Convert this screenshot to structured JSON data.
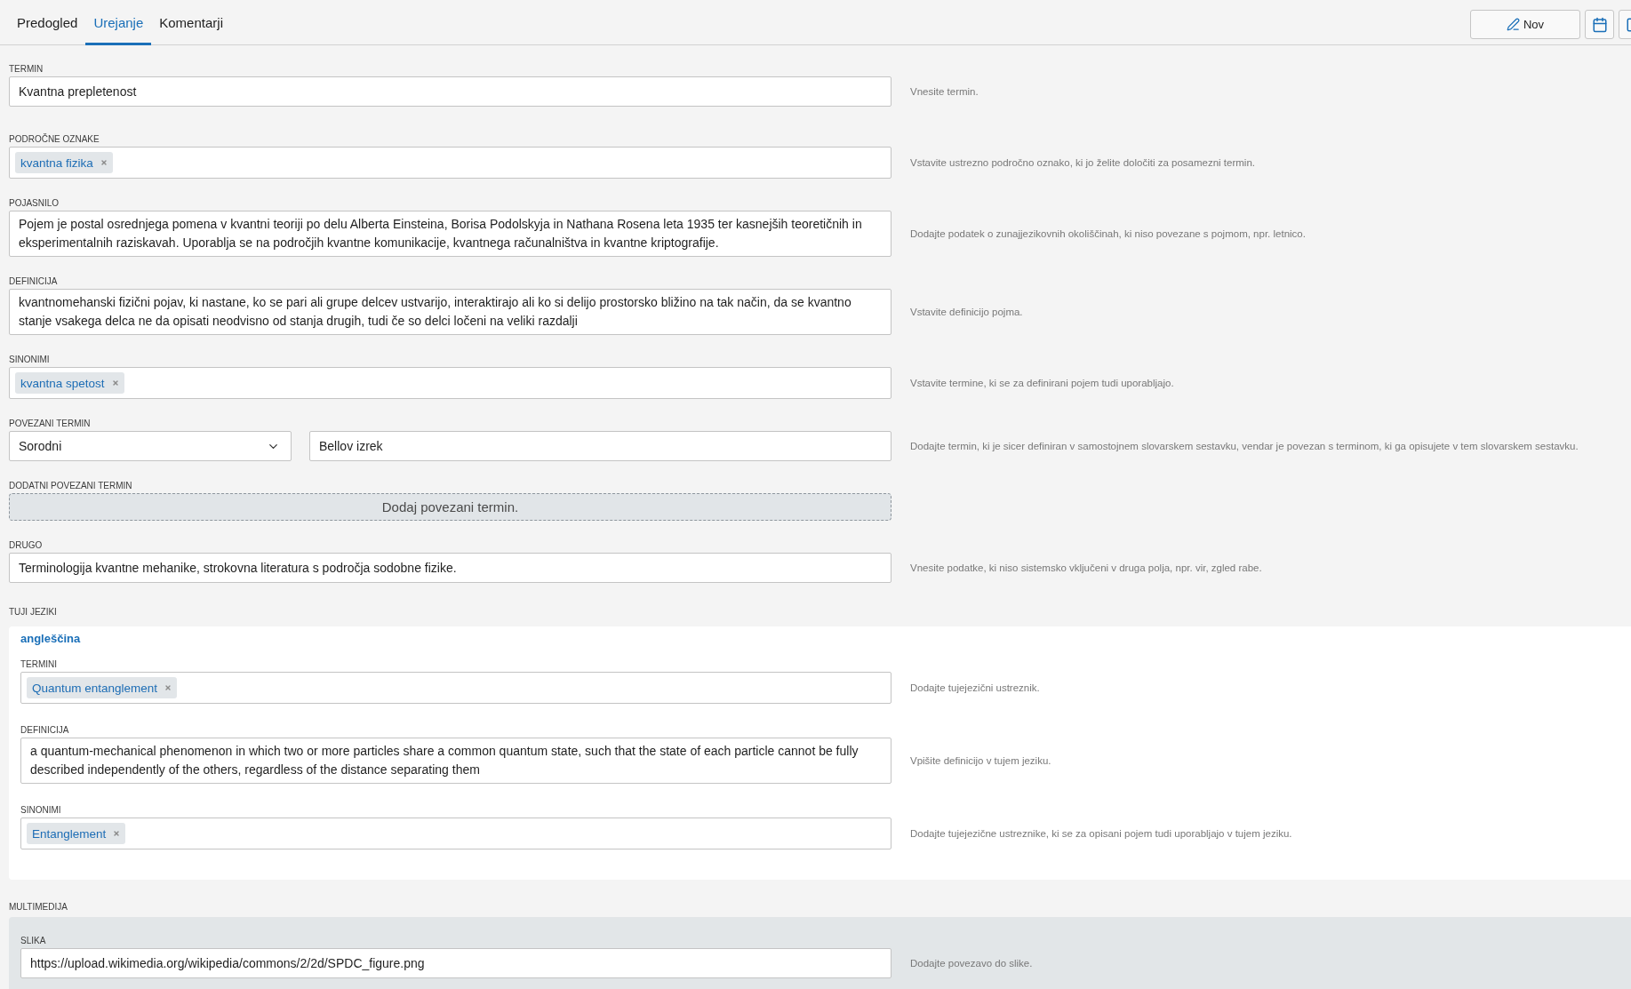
{
  "tabs": [
    {
      "label": "Predogled",
      "selected": false
    },
    {
      "label": "Urejanje",
      "selected": true
    },
    {
      "label": "Komentarji",
      "selected": false
    }
  ],
  "toolbar": {
    "new_button": {
      "label": "Nov"
    }
  },
  "fields": [
    {
      "kind": "text",
      "label": "TERMIN",
      "value": "Kvantna prepletenost",
      "hint": "Vnesite termin."
    },
    {
      "kind": "tags",
      "label": "PODROČNE OZNAKE",
      "tags": [
        "kvantna fizika"
      ],
      "hint": "Vstavite ustrezno področno oznako, ki jo želite določiti za posamezni termin."
    },
    {
      "kind": "textarea",
      "label": "POJASNILO",
      "value": "Pojem je postal osrednjega pomena v kvantni teoriji po delu Alberta Einsteina, Borisa Podolskyja in Nathana Rosena leta 1935 ter kasnejših teoretičnih in eksperimentalnih raziskavah. Uporablja se na področjih kvantne komunikacije, kvantnega računalništva in kvantne kriptografije.",
      "hint": "Dodajte podatek o zunajjezikovnih okoliščinah, ki niso povezane s pojmom, npr. letnico."
    },
    {
      "kind": "textarea",
      "label": "DEFINICIJA",
      "value": "kvantnomehanski fizični pojav, ki nastane, ko se pari ali grupe delcev ustvarijo, interaktirajo ali ko si delijo prostorsko bližino na tak način, da se kvantno stanje vsakega delca ne da opisati neodvisno od stanja drugih, tudi če so delci ločeni na veliki razdalji",
      "hint": "Vstavite definicijo pojma."
    },
    {
      "kind": "tags",
      "label": "SINONIMI",
      "tags": [
        "kvantna spetost"
      ],
      "hint": "Vstavite termine, ki se za definirani pojem tudi uporabljajo."
    },
    {
      "kind": "related",
      "label": "POVEZANI TERMIN",
      "relation": "Sorodni",
      "value": "Bellov izrek",
      "hint": "Dodajte termin, ki je sicer definiran v samostojnem slovarskem sestavku, vendar je povezan s terminom, ki ga opisujete v tem slovarskem sestavku."
    },
    {
      "kind": "add",
      "label": "DODATNI POVEZANI TERMIN",
      "button": "Dodaj povezani termin."
    },
    {
      "kind": "text",
      "label": "DRUGO",
      "value": "Terminologija kvantne mehanike, strokovna literatura s področja sodobne fizike.",
      "hint": "Vnesite podatke, ki niso sistemsko vključeni v druga polja, npr. vir, zgled rabe."
    }
  ],
  "foreign_languages": {
    "label": "TUJI JEZIKI",
    "languages": [
      {
        "name": "angleščina",
        "fields": [
          {
            "kind": "tags",
            "label": "TERMINI",
            "tags": [
              "Quantum entanglement"
            ],
            "hint": "Dodajte tujejezični ustreznik."
          },
          {
            "kind": "textarea",
            "label": "DEFINICIJA",
            "value": "a quantum-mechanical phenomenon in which two or more particles share a common quantum state, such that the state of each particle cannot be fully described independently of the others, regardless of the distance separating them",
            "hint": "Vpišite definicijo v tujem jeziku."
          },
          {
            "kind": "tags",
            "label": "SINONIMI",
            "tags": [
              "Entanglement"
            ],
            "hint": "Dodajte tujejezične ustreznike, ki se za opisani pojem tudi uporabljajo v tujem jeziku."
          }
        ]
      }
    ]
  },
  "multimedia": {
    "label": "MULTIMEDIJA",
    "fields": [
      {
        "kind": "text",
        "label": "SLIKA",
        "value": "https://upload.wikimedia.org/wikipedia/commons/2/2d/SPDC_figure.png",
        "hint": "Dodajte povezavo do slike."
      }
    ]
  }
}
